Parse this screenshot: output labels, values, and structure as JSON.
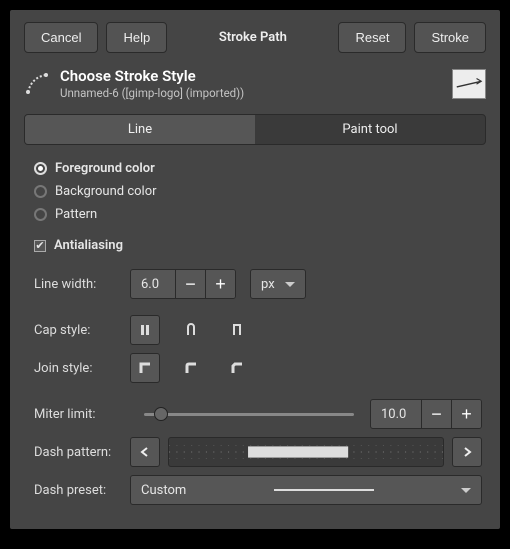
{
  "buttons": {
    "cancel": "Cancel",
    "help": "Help",
    "title": "Stroke Path",
    "reset": "Reset",
    "stroke": "Stroke"
  },
  "header": {
    "title": "Choose Stroke Style",
    "subtitle": "Unnamed-6 ([gimp-logo] (imported))"
  },
  "tabs": {
    "line": "Line",
    "paint_tool": "Paint tool"
  },
  "source": {
    "foreground": "Foreground color",
    "background": "Background color",
    "pattern": "Pattern"
  },
  "antialiasing": "Antialiasing",
  "line_width": {
    "label": "Line width:",
    "value": "6.0",
    "unit": "px"
  },
  "cap_style": {
    "label": "Cap style:"
  },
  "join_style": {
    "label": "Join style:"
  },
  "miter_limit": {
    "label": "Miter limit:",
    "value": "10.0"
  },
  "dash_pattern": {
    "label": "Dash pattern:"
  },
  "dash_preset": {
    "label": "Dash preset:",
    "value": "Custom"
  }
}
